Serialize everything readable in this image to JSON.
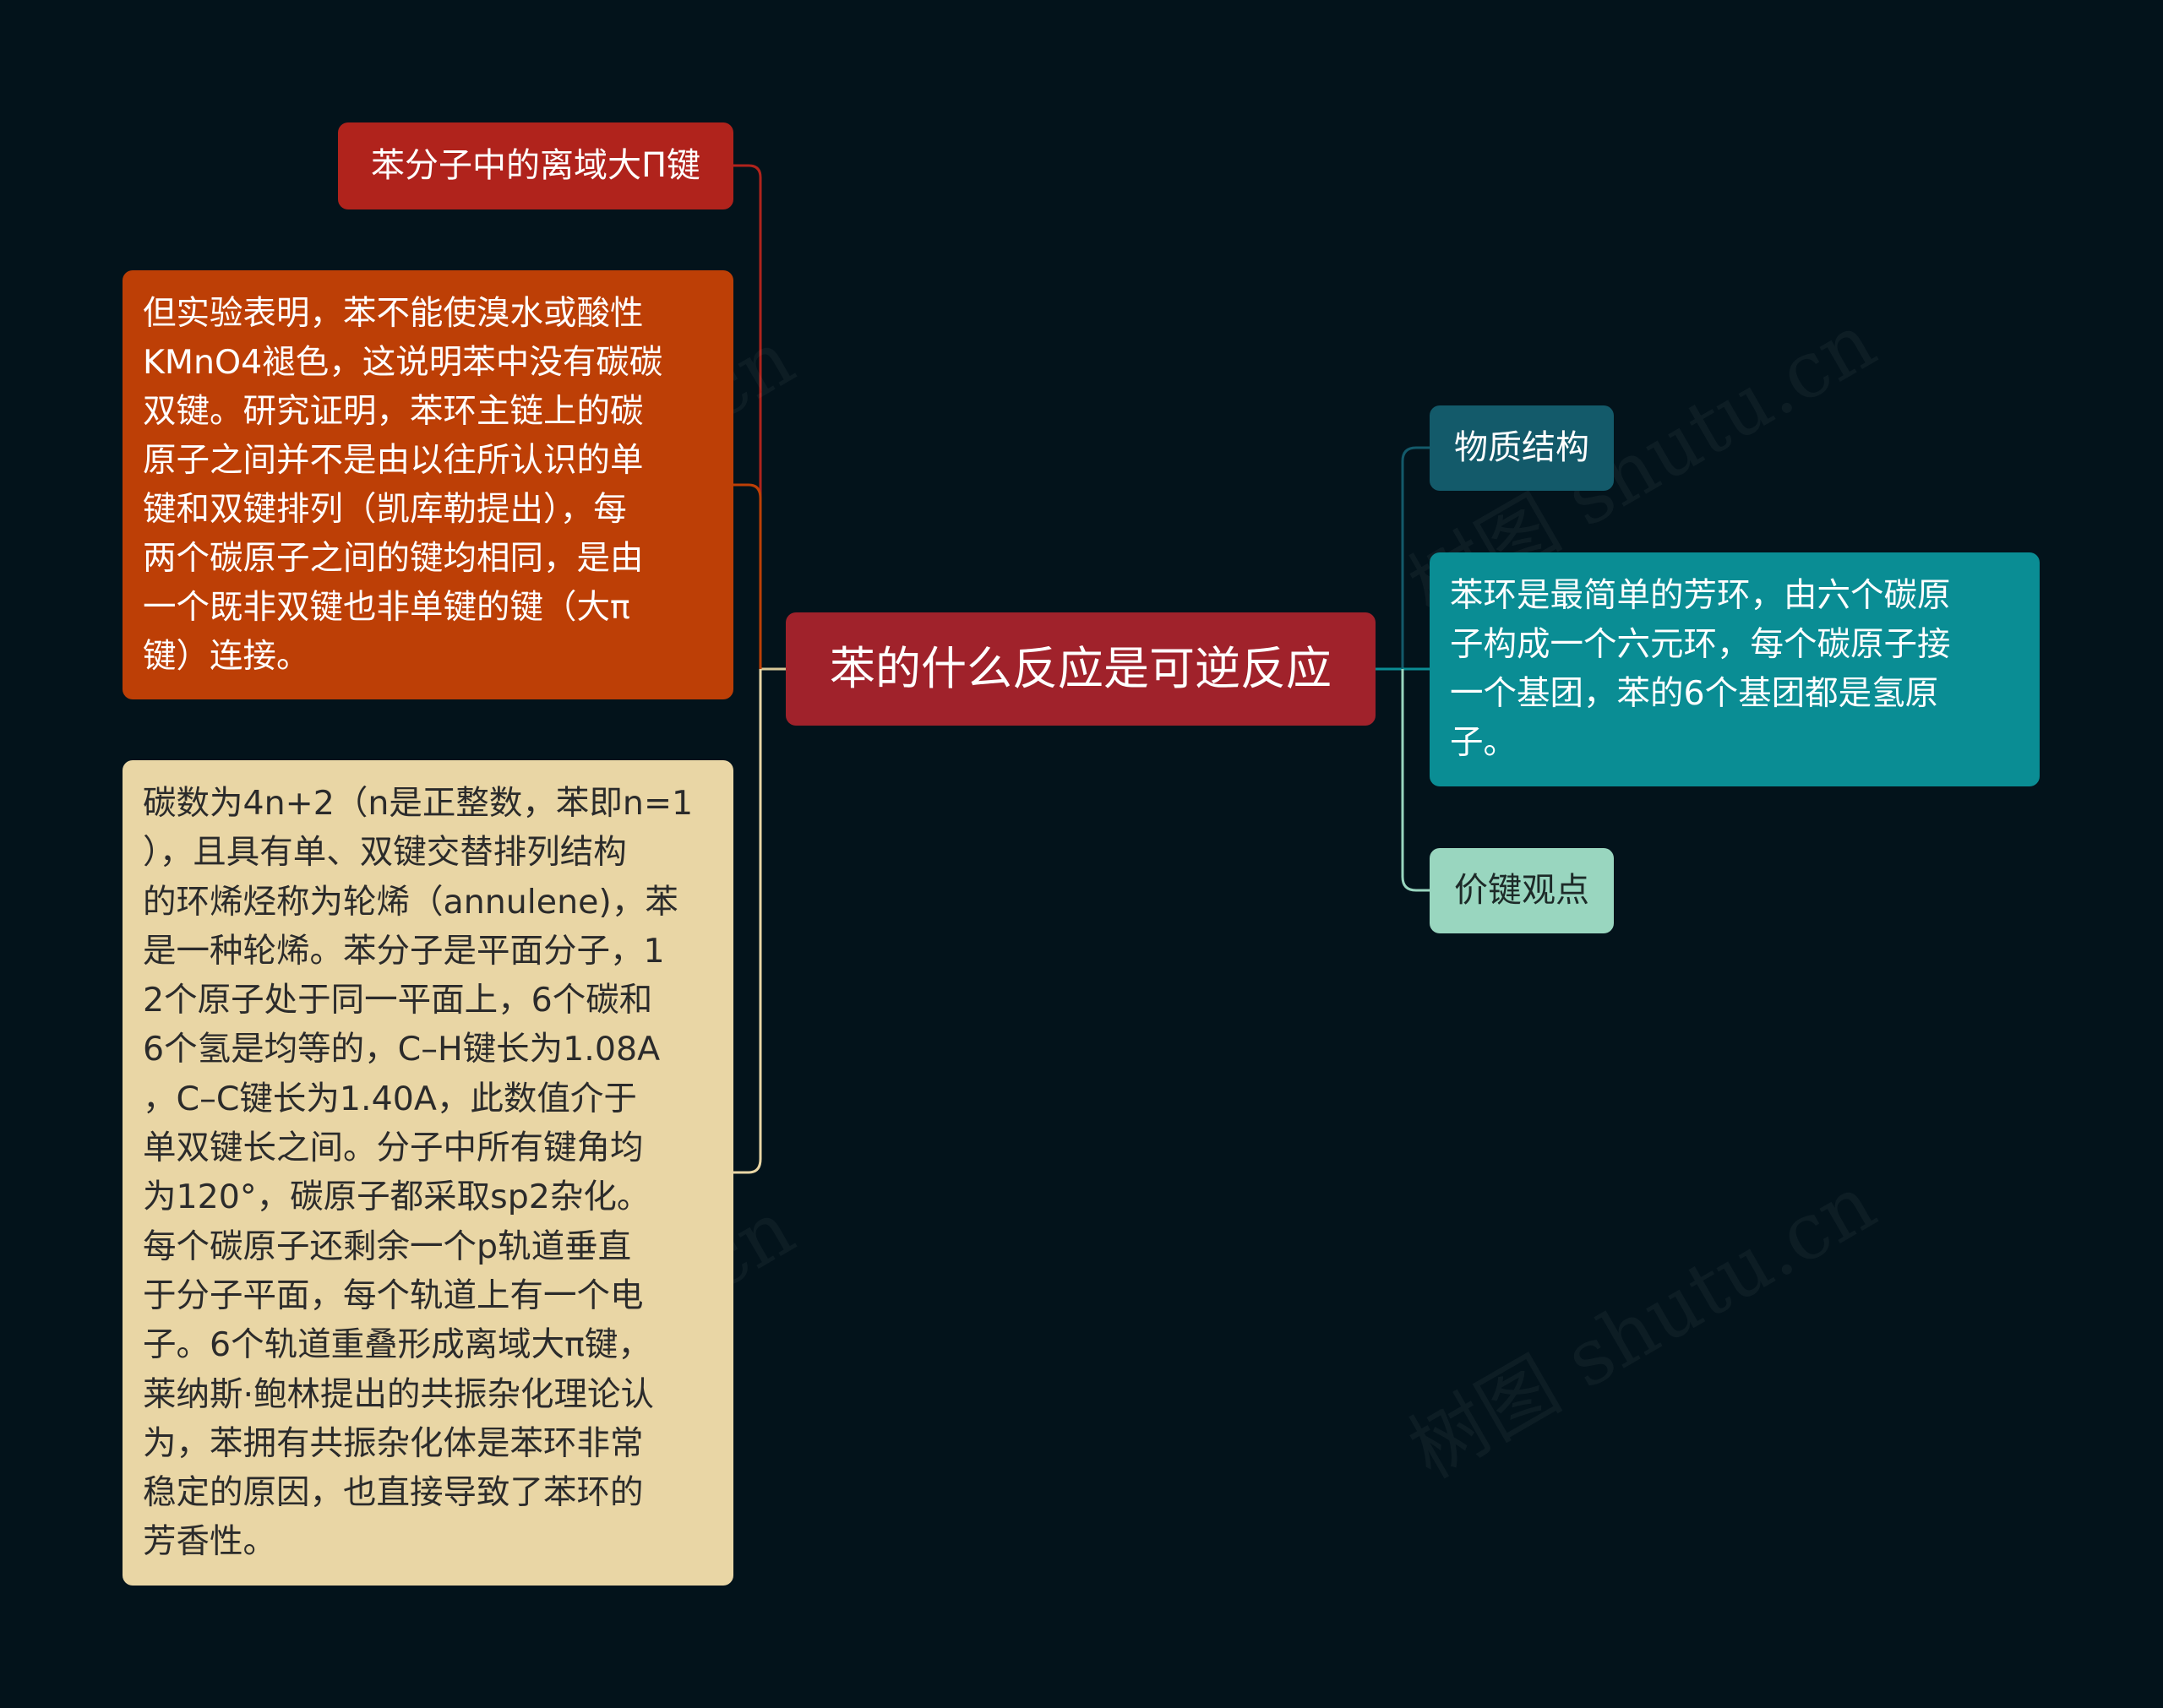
{
  "center": {
    "label": "苯的什么反应是可逆反应"
  },
  "left": {
    "title": "苯分子中的离域大Π键",
    "orange_text": "但实验表明，苯不能使溴水或酸性\nKMnO4褪色，这说明苯中没有碳碳\n双键。研究证明，苯环主链上的碳\n原子之间并不是由以往所认识的单\n键和双键排列（凯库勒提出），每\n两个碳原子之间的键均相同，是由\n一个既非双键也非单键的键（大π\n键）连接。",
    "beige_text": "碳数为4n+2（n是正整数，苯即n=1\n），且具有单、双键交替排列结构\n的环烯烃称为轮烯（annulene)，苯\n是一种轮烯。苯分子是平面分子，1\n2个原子处于同一平面上，6个碳和\n6个氢是均等的，C–H键长为1.08A\n，C–C键长为1.40A，此数值介于\n单双键长之间。分子中所有键角均\n为120°，碳原子都采取sp2杂化。\n每个碳原子还剩余一个p轨道垂直\n于分子平面，每个轨道上有一个电\n子。6个轨道重叠形成离域大π键，\n莱纳斯·鲍林提出的共振杂化理论认\n为，苯拥有共振杂化体是苯环非常\n稳定的原因，也直接导致了苯环的\n芳香性。"
  },
  "right": {
    "label1": "物质结构",
    "text": "苯环是最简单的芳环，由六个碳原\n子构成一个六元环，每个碳原子接\n一个基团，苯的6个基团都是氢原\n子。",
    "label2": "价键观点"
  },
  "watermark": "树图 shutu.cn",
  "colors": {
    "background": "#03131b",
    "center": "#a0222b",
    "left_title": "#b0231c",
    "left_orange": "#bd3f06",
    "left_beige": "#e9d6a5",
    "right_label1": "#135a6a",
    "right_text": "#0a8d94",
    "right_label2": "#99d6bf"
  }
}
